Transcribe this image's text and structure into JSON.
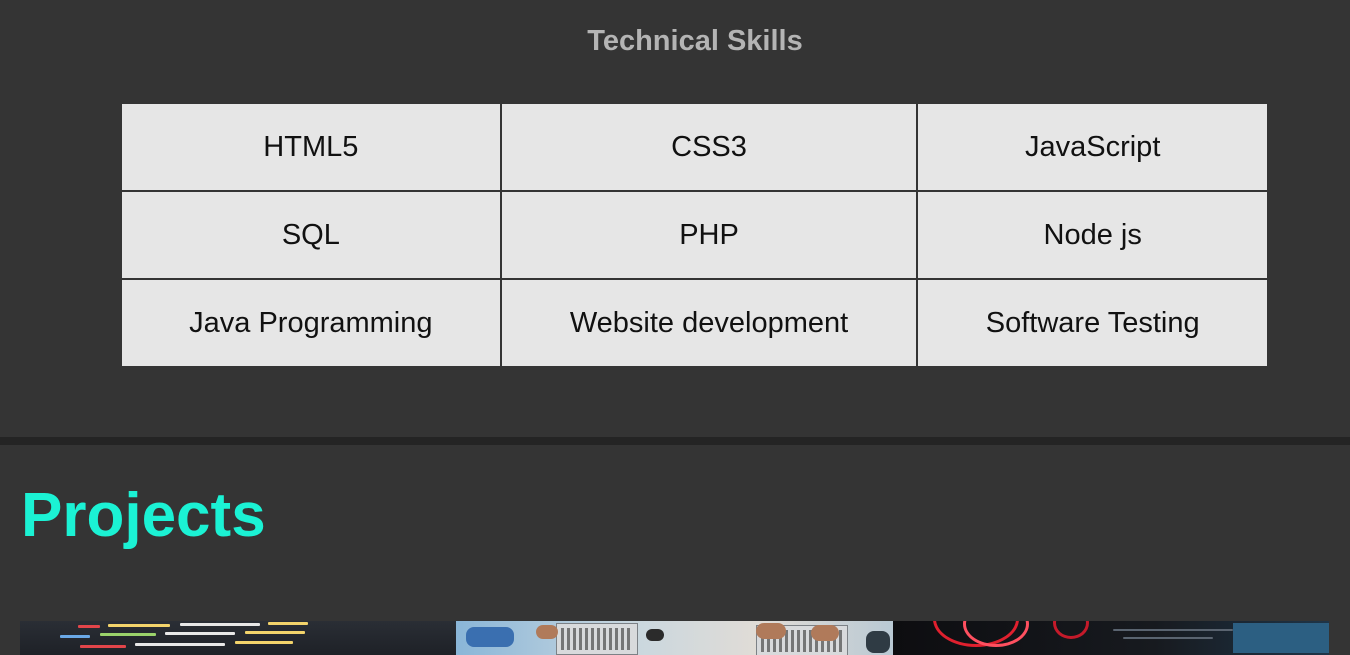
{
  "skills": {
    "heading": "Technical Skills",
    "rows": [
      [
        "HTML5",
        "CSS3",
        "JavaScript"
      ],
      [
        "SQL",
        "PHP",
        "Node js"
      ],
      [
        "Java Programming",
        "Website development",
        "Software Testing"
      ]
    ]
  },
  "projects": {
    "heading": "Projects",
    "thumbnails": [
      {
        "name": "code-editor-thumbnail"
      },
      {
        "name": "team-laptops-thumbnail"
      },
      {
        "name": "dark-monitor-thumbnail"
      }
    ]
  },
  "colors": {
    "page_background": "#343434",
    "divider": "#242424",
    "heading_gray": "#b4b4b4",
    "cell_background": "#e6e6e6",
    "accent": "#1bf2d4"
  }
}
